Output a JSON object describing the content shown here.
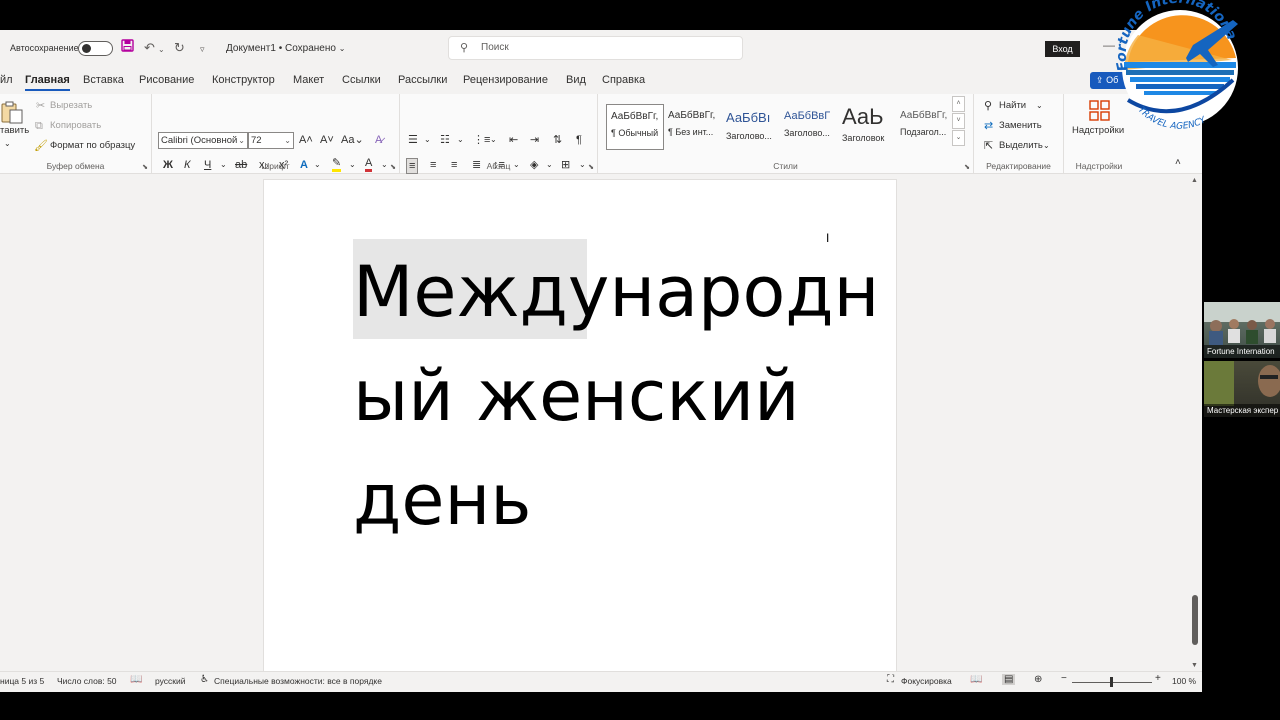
{
  "titlebar": {
    "autosave_label": "Автосохранение",
    "doc_title": "Документ1 • Сохранено",
    "search_placeholder": "Поиск",
    "signin_label": "Вход"
  },
  "tabs": [
    {
      "label": "йл"
    },
    {
      "label": "Главная"
    },
    {
      "label": "Вставка"
    },
    {
      "label": "Рисование"
    },
    {
      "label": "Конструктор"
    },
    {
      "label": "Макет"
    },
    {
      "label": "Ссылки"
    },
    {
      "label": "Рассылки"
    },
    {
      "label": "Рецензирование"
    },
    {
      "label": "Вид"
    },
    {
      "label": "Справка"
    }
  ],
  "share_label": "Об",
  "ribbon": {
    "clipboard": {
      "paste_label": "тавить",
      "cut": "Вырезать",
      "copy": "Копировать",
      "format_painter": "Формат по образцу",
      "group_label": "Буфер обмена"
    },
    "font": {
      "font_name": "Calibri (Основной",
      "font_size": "72",
      "group_label": "Шрифт"
    },
    "paragraph": {
      "group_label": "Абзац"
    },
    "styles": {
      "items": [
        {
          "sample": "АаБбВвГг,",
          "name": "¶ Обычный"
        },
        {
          "sample": "АаБбВвГг,",
          "name": "¶ Без инт..."
        },
        {
          "sample": "АаБбВı",
          "name": "Заголово..."
        },
        {
          "sample": "АаБбВвГ",
          "name": "Заголово..."
        },
        {
          "sample": "АаЬ",
          "name": "Заголовок"
        },
        {
          "sample": "АаБбВвГг,",
          "name": "Подзагол..."
        }
      ],
      "group_label": "Стили"
    },
    "editing": {
      "find": "Найти",
      "replace": "Заменить",
      "select": "Выделить",
      "group_label": "Редактирование"
    },
    "addins": {
      "button_label": "Надстройки",
      "group_label": "Надстройки"
    }
  },
  "document": {
    "lines": [
      "Международн",
      "ый женский",
      "день"
    ]
  },
  "statusbar": {
    "page": "ница 5 из 5",
    "words": "Число слов: 50",
    "language": "русский",
    "accessibility": "Специальные возможности: все в порядке",
    "focus": "Фокусировка",
    "zoom": "100 %"
  },
  "logo": {
    "top_text": "Fortune International",
    "bottom_text": "TRAVEL AGENCY"
  },
  "video_tiles": [
    {
      "name": "Fortune Internation"
    },
    {
      "name": "Мастерская экспер"
    }
  ],
  "colors": {
    "accent": "#185abd",
    "background": "#f3f2f1",
    "ribbon": "#fafafa"
  }
}
